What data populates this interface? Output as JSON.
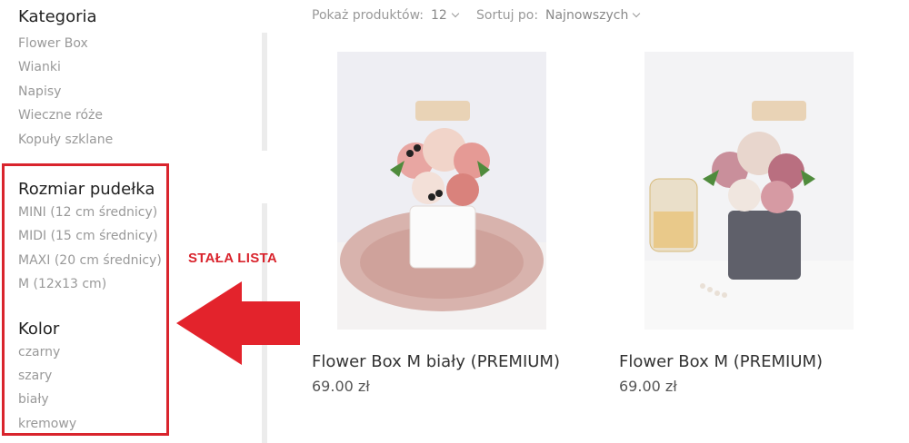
{
  "sidebar": {
    "category": {
      "heading": "Kategoria",
      "items": [
        "Flower Box",
        "Wianki",
        "Napisy",
        "Wieczne róże",
        "Kopuły szklane"
      ]
    },
    "box_size": {
      "heading": "Rozmiar pudełka",
      "items": [
        "MINI (12 cm średnicy)",
        "MIDI (15 cm średnicy)",
        "MAXI (20 cm średnicy)",
        "M (12x13 cm)"
      ]
    },
    "color": {
      "heading": "Kolor",
      "items": [
        "czarny",
        "szary",
        "biały",
        "kremowy"
      ]
    }
  },
  "annotation": {
    "label": "STAŁA LISTA",
    "color": "#d9242d"
  },
  "toolbar": {
    "show_label": "Pokaż produktów:",
    "show_value": "12",
    "sort_label": "Sortuj po:",
    "sort_value": "Najnowszych"
  },
  "products": [
    {
      "title": "Flower Box M biały (PREMIUM)",
      "price": "69.00 zł"
    },
    {
      "title": "Flower Box M (PREMIUM)",
      "price": "69.00 zł"
    }
  ],
  "icons": [
    "chevron-down-icon",
    "arrow-left-icon"
  ]
}
